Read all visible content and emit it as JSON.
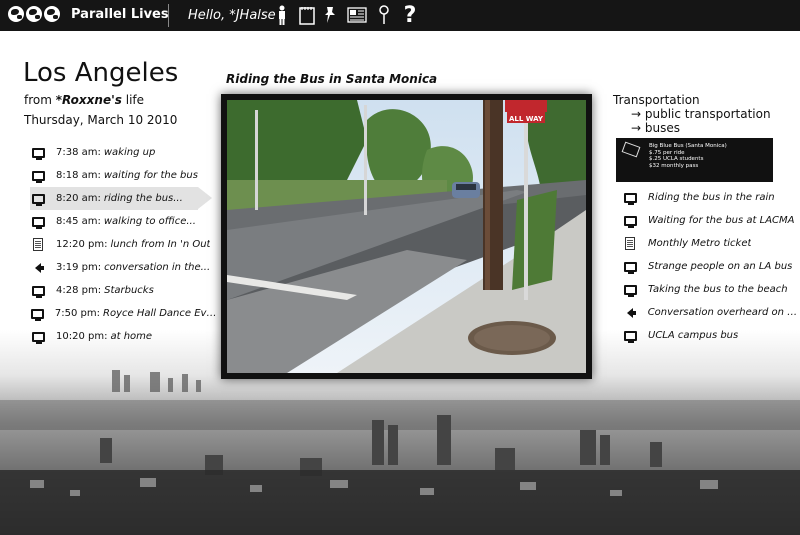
{
  "app": {
    "title": "Parallel Lives",
    "greeting": "Hello, *JHalse"
  },
  "toolbar": {
    "icons": [
      "person-icon",
      "notepad-icon",
      "pin-icon",
      "newspaper-icon",
      "map-marker-icon",
      "help-icon"
    ]
  },
  "location": {
    "city": "Los Angeles",
    "from_prefix": "from",
    "user": "*Roxxne's",
    "from_suffix": "life",
    "date": "Thursday, March 10 2010"
  },
  "timeline": [
    {
      "time": "7:38 am:",
      "desc": "waking up",
      "icon": "monitor-icon"
    },
    {
      "time": "8:18 am:",
      "desc": "waiting for the bus",
      "icon": "monitor-icon"
    },
    {
      "time": "8:20 am:",
      "desc": "riding the bus...",
      "icon": "monitor-icon",
      "active": true
    },
    {
      "time": "8:45 am:",
      "desc": "walking to office...",
      "icon": "monitor-icon"
    },
    {
      "time": "12:20 pm:",
      "desc": "lunch from In 'n Out",
      "icon": "document-icon"
    },
    {
      "time": "3:19 pm:",
      "desc": "conversation in the...",
      "icon": "speaker-icon"
    },
    {
      "time": "4:28 pm:",
      "desc": "Starbucks",
      "icon": "monitor-icon"
    },
    {
      "time": "7:50 pm:",
      "desc": "Royce Hall Dance Even...",
      "icon": "monitor-icon"
    },
    {
      "time": "10:20 pm:",
      "desc": "at home",
      "icon": "monitor-icon"
    }
  ],
  "video": {
    "title": "Riding the Bus in Santa Monica",
    "sign_text": "ALL WAY"
  },
  "sidebar": {
    "category": "Transportation",
    "sub1": "→ public transportation",
    "sub2": "→ buses",
    "card": {
      "line1": "Big Blue Bus (Santa Monica)",
      "line2": "$.75 per ride",
      "line3": "$.25 UCLA students",
      "line4": "$32 monthly pass"
    },
    "items": [
      {
        "label": "Riding the bus in the rain",
        "icon": "monitor-icon"
      },
      {
        "label": "Waiting for the bus at LACMA",
        "icon": "monitor-icon"
      },
      {
        "label": "Monthly Metro ticket",
        "icon": "document-icon"
      },
      {
        "label": "Strange people on an LA bus",
        "icon": "monitor-icon"
      },
      {
        "label": "Taking the bus to the beach",
        "icon": "monitor-icon"
      },
      {
        "label": "Conversation overheard on bus",
        "icon": "speaker-icon"
      },
      {
        "label": "UCLA campus bus",
        "icon": "monitor-icon"
      }
    ]
  }
}
